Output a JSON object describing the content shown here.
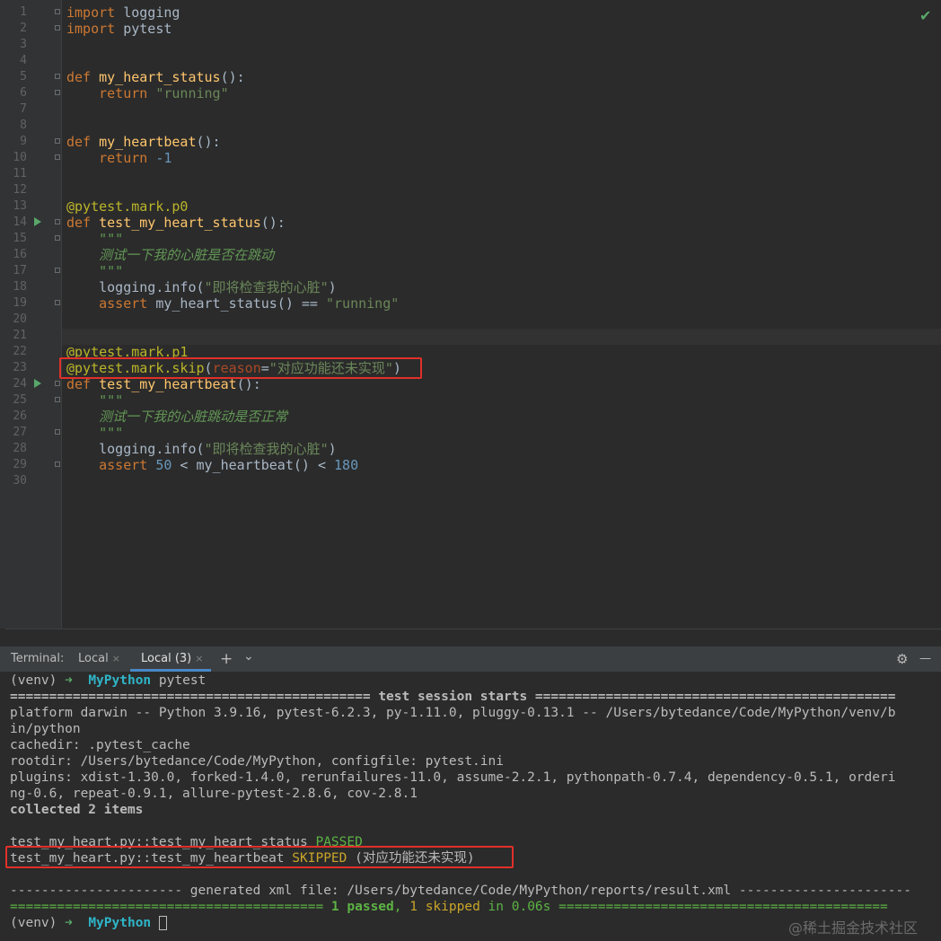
{
  "editor": {
    "line_numbers": [
      "1",
      "2",
      "3",
      "4",
      "5",
      "6",
      "7",
      "8",
      "9",
      "10",
      "11",
      "12",
      "13",
      "14",
      "15",
      "16",
      "17",
      "18",
      "19",
      "20",
      "21",
      "22",
      "23",
      "24",
      "25",
      "26",
      "27",
      "28",
      "29",
      "30"
    ],
    "code": {
      "l1_kw": "import",
      "l1_rest": " logging",
      "l2_kw": "import",
      "l2_rest": " pytest",
      "l5_kw": "def",
      "l5_fn": "my_heart_status",
      "l5_rest": "():",
      "l6_kw": "return",
      "l6_str": "\"running\"",
      "l9_kw": "def",
      "l9_fn": "my_heartbeat",
      "l9_rest": "():",
      "l10_kw": "return",
      "l10_num": "-1",
      "l13_dec": "@pytest.mark.p0",
      "l14_kw": "def",
      "l14_fn": "test_my_heart_status",
      "l14_rest": "():",
      "l15_doc": "\"\"\"",
      "l16_doc": "测试一下我的心脏是否在跳动",
      "l17_doc": "\"\"\"",
      "l18_a": "logging.info(",
      "l18_str": "\"即将检查我的心脏\"",
      "l18_b": ")",
      "l19_kw": "assert",
      "l19_rest": " my_heart_status() == ",
      "l19_str": "\"running\"",
      "l22_dec": "@pytest.mark.p1",
      "l23_dec": "@pytest.mark.skip",
      "l23_paren": "(",
      "l23_param": "reason",
      "l23_eq": "=",
      "l23_str": "\"对应功能还未实现\"",
      "l23_close": ")",
      "l24_kw": "def",
      "l24_fn": "test_my_heartbeat",
      "l24_rest": "():",
      "l25_doc": "\"\"\"",
      "l26_doc": "测试一下我的心脏跳动是否正常",
      "l27_doc": "\"\"\"",
      "l28_a": "logging.info(",
      "l28_str": "\"即将检查我的心脏\"",
      "l28_b": ")",
      "l29_kw": "assert",
      "l29_num1": "50",
      "l29_mid": " < my_heartbeat() < ",
      "l29_num2": "180"
    },
    "status_icon": "check-icon",
    "status_glyph": "✔"
  },
  "terminal_header": {
    "label": "Terminal:",
    "tabs": [
      "Local",
      "Local (3)"
    ],
    "close_glyph": "×",
    "add_glyph": "+",
    "dropdown_glyph": "⌄",
    "settings_glyph": "⚙",
    "minimize_glyph": "—"
  },
  "terminal": {
    "prompt_venv": "(venv)",
    "prompt_arrow": "➜",
    "prompt_dir": "MyPython",
    "command": "pytest",
    "session_left": "============================================== ",
    "session_title": "test session starts",
    "session_right": " ==============================================",
    "platform_1": "platform darwin -- Python 3.9.16, pytest-6.2.3, py-1.11.0, pluggy-0.13.1 -- /Users/bytedance/Code/MyPython/venv/b",
    "platform_2": "in/python",
    "cachedir": "cachedir: .pytest_cache",
    "rootdir": "rootdir: /Users/bytedance/Code/MyPython, configfile: pytest.ini",
    "plugins_1": "plugins: xdist-1.30.0, forked-1.4.0, rerunfailures-11.0, assume-2.2.1, pythonpath-0.7.4, dependency-0.5.1, orderi",
    "plugins_2": "ng-0.6, repeat-0.9.1, allure-pytest-2.8.6, cov-2.8.1",
    "collected": "collected 2 items",
    "result1_test": "test_my_heart.py::test_my_heart_status ",
    "result1_status": "PASSED",
    "result2_test": "test_my_heart.py::test_my_heartbeat ",
    "result2_status": "SKIPPED",
    "result2_reason": " (对应功能还未实现)",
    "xml_line": "---------------------- generated xml file: /Users/bytedance/Code/MyPython/reports/result.xml ----------------------",
    "summary_left": "======================================== ",
    "summary_passed": "1 passed",
    "summary_comma": ", ",
    "summary_skipped": "1 skipped",
    "summary_time": " in 0.06s",
    "summary_right": " ==========================================",
    "final_prompt_venv": "(venv)",
    "final_prompt_arrow": "➜",
    "final_prompt_dir": "MyPython"
  },
  "watermark": "@稀土掘金技术社区"
}
